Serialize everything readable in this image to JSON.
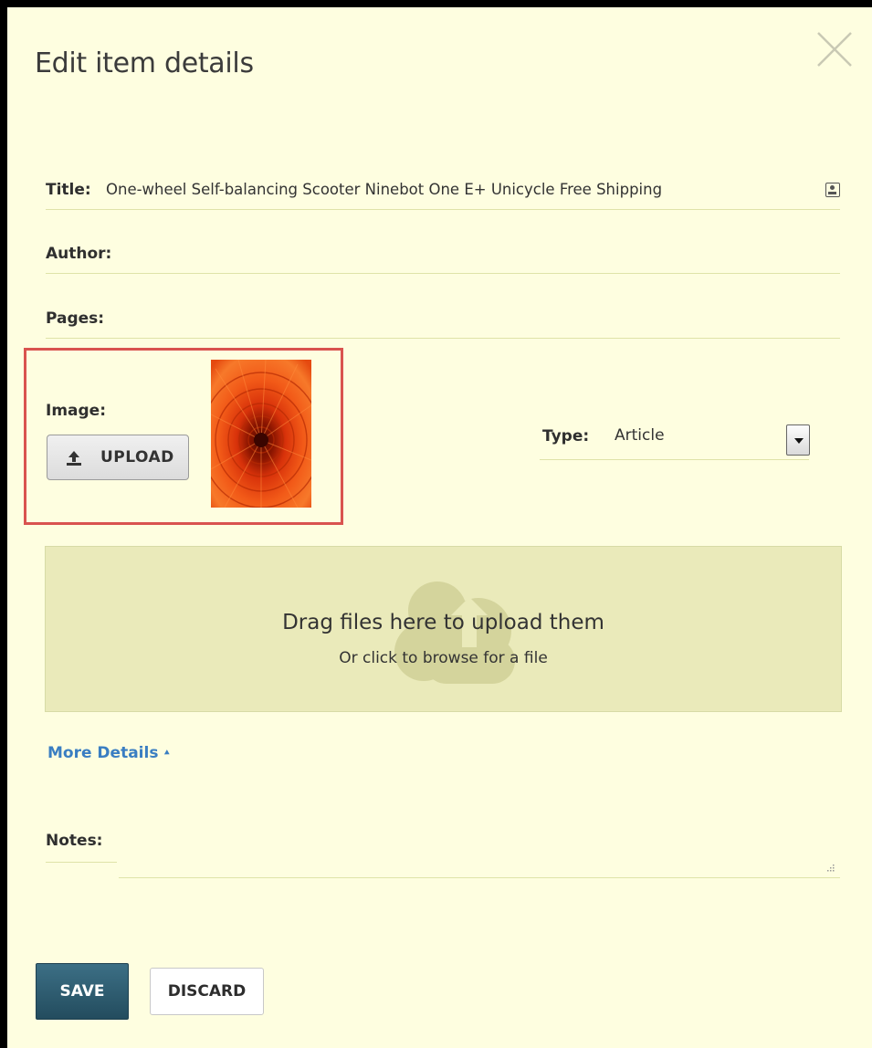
{
  "dialog": {
    "title": "Edit item details"
  },
  "fields": {
    "title_label": "Title:",
    "title_value": "One-wheel Self-balancing Scooter Ninebot One E+ Unicycle Free Shipping",
    "author_label": "Author:",
    "author_value": "",
    "pages_label": "Pages:",
    "pages_value": ""
  },
  "image": {
    "label": "Image:",
    "upload_label": "UPLOAD",
    "thumbnail_desc": "orange-flower-photo"
  },
  "type": {
    "label": "Type:",
    "selected": "Article"
  },
  "dropzone": {
    "title": "Drag files here to upload them",
    "subtitle": "Or click to browse for a file"
  },
  "more_details": {
    "label": "More Details"
  },
  "notes": {
    "label": "Notes:",
    "value": ""
  },
  "actions": {
    "save_label": "SAVE",
    "discard_label": "DISCARD"
  },
  "colors": {
    "panel_bg": "#fefee0",
    "highlight": "#d9534f",
    "link": "#3a7ec2",
    "save_bg": "#2f5d72",
    "dropzone_bg": "#eaeaba"
  },
  "icons": {
    "close": "close-icon",
    "contact": "contact-card-icon",
    "upload": "upload-icon",
    "cloud": "cloud-upload-icon",
    "caret": "caret-right-icon",
    "resize": "resize-grip-icon"
  }
}
